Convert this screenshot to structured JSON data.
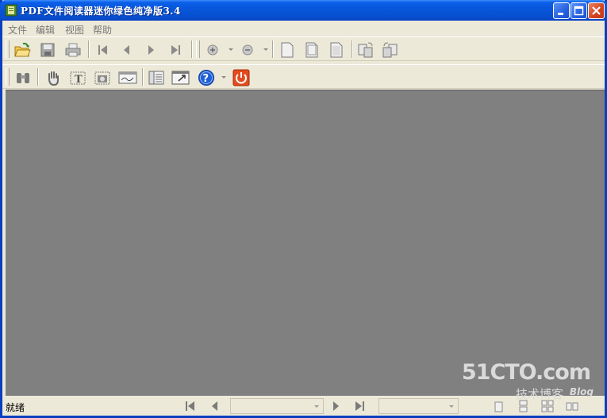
{
  "window": {
    "title": "PDF文件阅读器迷你绿色纯净版3.4",
    "controls": [
      "minimize",
      "maximize",
      "close"
    ]
  },
  "menu": {
    "items": [
      {
        "label": "文件"
      },
      {
        "label": "编辑"
      },
      {
        "label": "视图"
      },
      {
        "label": "帮助"
      }
    ]
  },
  "toolbar1": {
    "icons": [
      "open-folder-icon",
      "save-icon",
      "print-icon",
      "first-page-icon",
      "previous-page-icon",
      "next-page-icon",
      "last-page-icon",
      "zoom-in-icon",
      "zoom-out-icon",
      "fit-page-icon",
      "fit-width-icon",
      "actual-size-icon",
      "rotate-right-icon",
      "rotate-left-icon"
    ]
  },
  "toolbar2": {
    "icons": [
      "find-binoculars-icon",
      "hand-tool-icon",
      "text-select-icon",
      "snapshot-icon",
      "signature-icon",
      "bookmarks-panel-icon",
      "full-screen-icon",
      "help-icon",
      "exit-icon"
    ]
  },
  "watermark": {
    "main": "51CTO.com",
    "sub": "技术博客",
    "blog": "Blog"
  },
  "status": {
    "text": "就绪",
    "page_value": "",
    "zoom_value": ""
  },
  "colors": {
    "titlebar": "#0754d8",
    "workspace": "#808080",
    "chrome": "#ece9d8",
    "exit_button": "#e44a1c",
    "help_button": "#1f5fd6"
  }
}
